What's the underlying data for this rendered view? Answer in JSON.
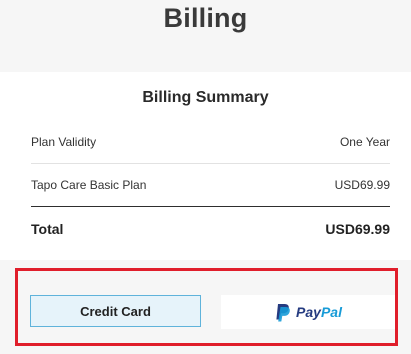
{
  "page": {
    "title": "Billing"
  },
  "summary": {
    "title": "Billing Summary",
    "rows": [
      {
        "label": "Plan Validity",
        "value": "One Year"
      },
      {
        "label": "Tapo Care Basic Plan",
        "value": "USD69.99"
      }
    ],
    "total": {
      "label": "Total",
      "value": "USD69.99"
    }
  },
  "payment": {
    "credit_card_label": "Credit Card",
    "paypal": {
      "brand_pay": "Pay",
      "brand_pal": "Pal",
      "icon": "paypal-p-icon"
    }
  },
  "colors": {
    "highlight_border": "#e01e2b",
    "credit_bg": "#e6f3fa",
    "credit_border": "#5fb3db",
    "paypal_dark": "#253b80",
    "paypal_light": "#179bd7"
  }
}
